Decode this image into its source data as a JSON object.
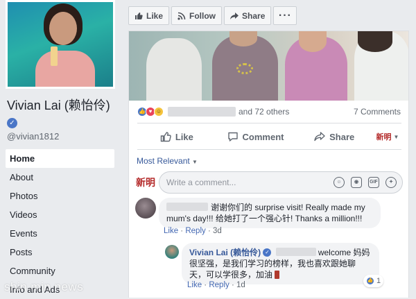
{
  "profile": {
    "name": "Vivian Lai (赖怡伶)",
    "handle": "@vivian1812"
  },
  "nav": [
    {
      "label": "Home",
      "active": true
    },
    {
      "label": "About"
    },
    {
      "label": "Photos"
    },
    {
      "label": "Videos"
    },
    {
      "label": "Events"
    },
    {
      "label": "Posts"
    },
    {
      "label": "Community"
    },
    {
      "label": "Info and Ads"
    }
  ],
  "page_actions": {
    "like": "Like",
    "follow": "Follow",
    "share": "Share",
    "more": "···"
  },
  "post": {
    "reactions_text": "and 72 others",
    "comments_count": "7 Comments",
    "actions": {
      "like": "Like",
      "comment": "Comment",
      "share": "Share"
    }
  },
  "comments_section": {
    "sort_label": "Most Relevant",
    "composer_logo": "新明",
    "placeholder": "Write a comment...",
    "composer_icons": [
      "emoji-icon",
      "camera-icon",
      "gif-icon",
      "sticker-icon"
    ]
  },
  "comment1": {
    "text": "谢谢你们的 surprise visit! Really made my mum's day!!! 给她打了一个强心针! Thanks a million!!!",
    "like": "Like",
    "reply": "Reply",
    "time": "3d"
  },
  "reply1": {
    "author": "Vivian Lai (赖怡伶)",
    "text": "welcome 妈妈很坚强，是我们学习的榜样，我也喜欢跟她聊天，可以学很多，加油",
    "like": "Like",
    "reply": "Reply",
    "time": "1d",
    "likes": "1"
  },
  "watermark": "shin min news",
  "colors": {
    "accent": "#4267b2",
    "link": "#365899",
    "bg": "#e9ebee"
  }
}
